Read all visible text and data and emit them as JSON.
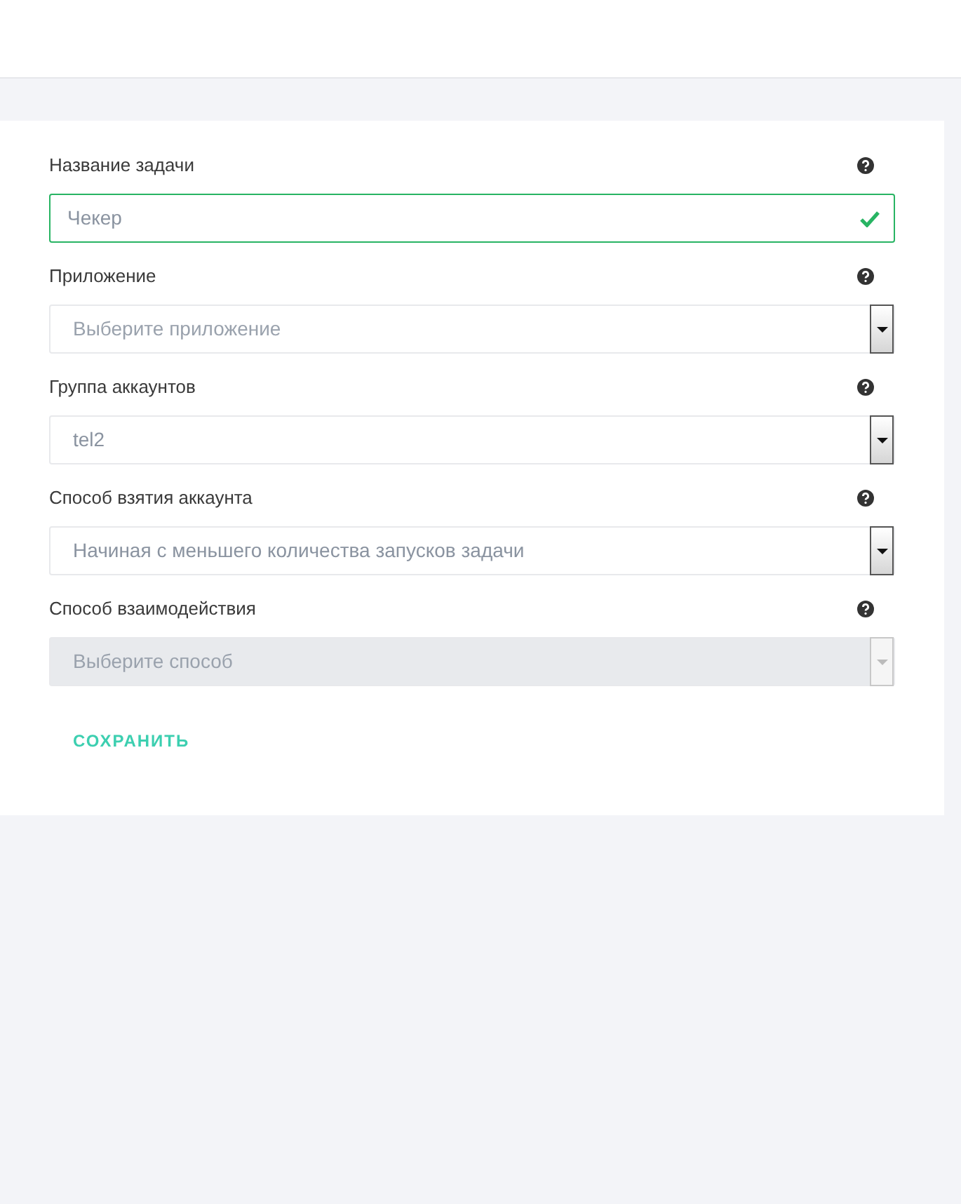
{
  "form": {
    "fields": [
      {
        "kind": "text",
        "label": "Название задачи",
        "value": "Чекер",
        "valid": true,
        "disabled": false
      },
      {
        "kind": "select",
        "label": "Приложение",
        "placeholder": "Выберите приложение",
        "disabled": false
      },
      {
        "kind": "select",
        "label": "Группа аккаунтов",
        "value": "tel2",
        "disabled": false
      },
      {
        "kind": "select",
        "label": "Способ взятия аккаунта",
        "value": "Начиная с меньшего количества запусков задачи",
        "disabled": false
      },
      {
        "kind": "select",
        "label": "Способ взаимодействия",
        "placeholder": "Выберите способ",
        "disabled": true
      }
    ],
    "submit": "СОХРАНИТЬ"
  }
}
